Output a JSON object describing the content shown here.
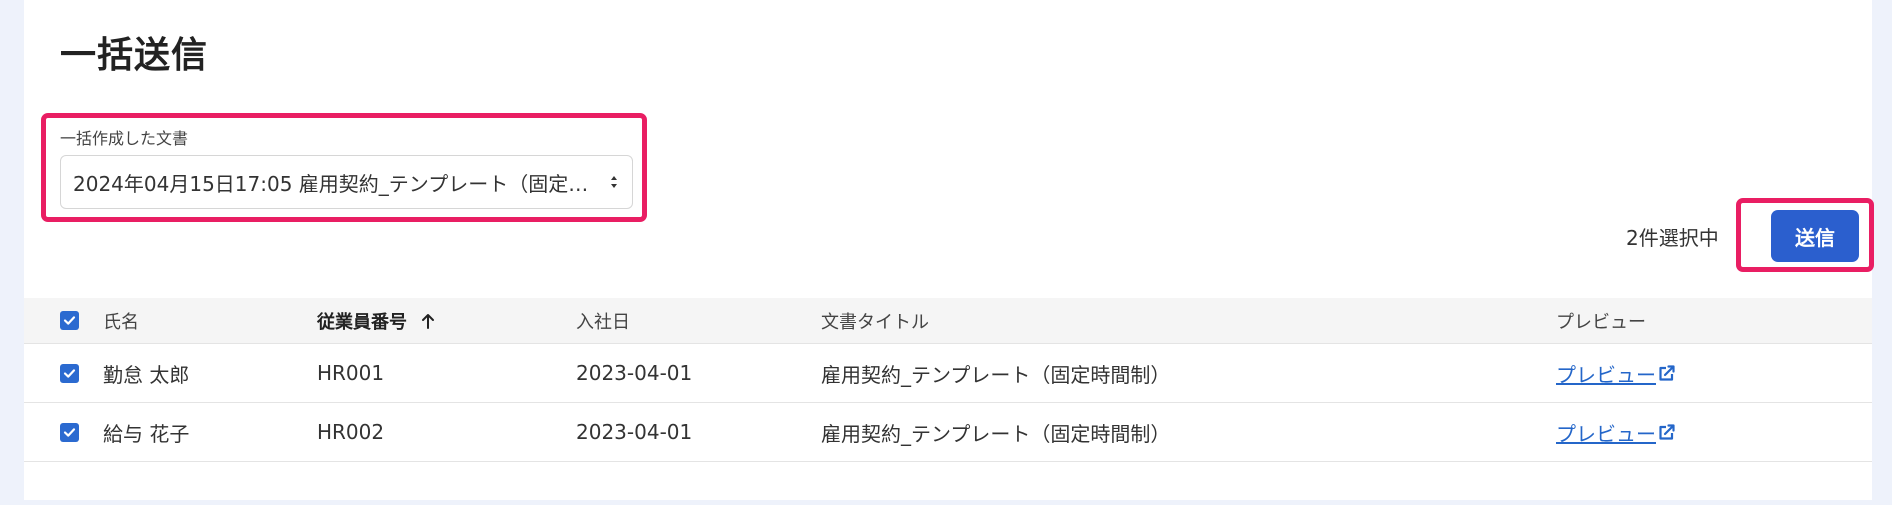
{
  "page": {
    "title": "一括送信"
  },
  "document_select": {
    "label": "一括作成した文書",
    "selected_value": "2024年04月15日17:05 雇用契約_テンプレート（固定…"
  },
  "toolbar": {
    "selection_count": "2件選択中",
    "send_label": "送信"
  },
  "table": {
    "headers": {
      "name": "氏名",
      "employee_number": "従業員番号",
      "hire_date": "入社日",
      "document_title": "文書タイトル",
      "preview": "プレビュー"
    },
    "sort": {
      "column": "employee_number",
      "direction": "ascending"
    },
    "select_all_checked": true,
    "rows": [
      {
        "checked": true,
        "name": "勤怠 太郎",
        "employee_number": "HR001",
        "hire_date": "2023-04-01",
        "document_title": "雇用契約_テンプレート（固定時間制）",
        "preview_label": "プレビュー"
      },
      {
        "checked": true,
        "name": "給与 花子",
        "employee_number": "HR002",
        "hire_date": "2023-04-01",
        "document_title": "雇用契約_テンプレート（固定時間制）",
        "preview_label": "プレビュー"
      }
    ]
  },
  "icons": {
    "sort": "arrow-up-icon",
    "select": "select-arrows-icon",
    "external": "external-link-icon",
    "check": "checkmark-icon"
  },
  "colors": {
    "primary": "#2b5fce",
    "link": "#2466c9",
    "highlight": "#e91e63",
    "checkbox": "#2b6ad0",
    "background": "#eef2fb"
  }
}
